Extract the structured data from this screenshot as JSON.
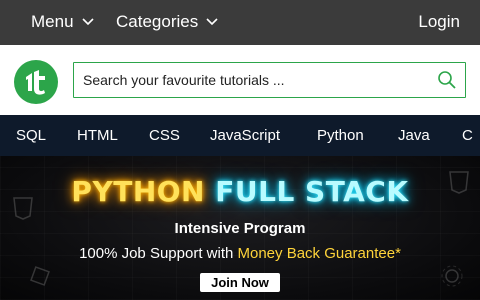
{
  "topbar": {
    "menu_label": "Menu",
    "categories_label": "Categories",
    "login_label": "Login"
  },
  "search": {
    "placeholder": "Search your favourite tutorials ..."
  },
  "nav": {
    "languages": [
      "SQL",
      "HTML",
      "CSS",
      "JavaScript",
      "Python",
      "Java",
      "C"
    ]
  },
  "banner": {
    "title_part1": "PYTHON",
    "title_part2": "FULL STACK",
    "subtitle": "Intensive Program",
    "tagline_prefix": "100% Job Support with",
    "tagline_highlight": "Money Back Guarantee*",
    "cta_label": "Join Now"
  },
  "icons": {
    "logo": "tutorialspoint-logo",
    "search": "search-icon",
    "chevron": "chevron-down-icon"
  },
  "colors": {
    "topbar_bg": "#3b3b3b",
    "brand_green": "#2ca54a",
    "nav_bg": "#0e1a2b",
    "neon_yellow": "#ffe15a",
    "neon_cyan": "#b8fbff",
    "highlight_yellow": "#ffd43a"
  }
}
